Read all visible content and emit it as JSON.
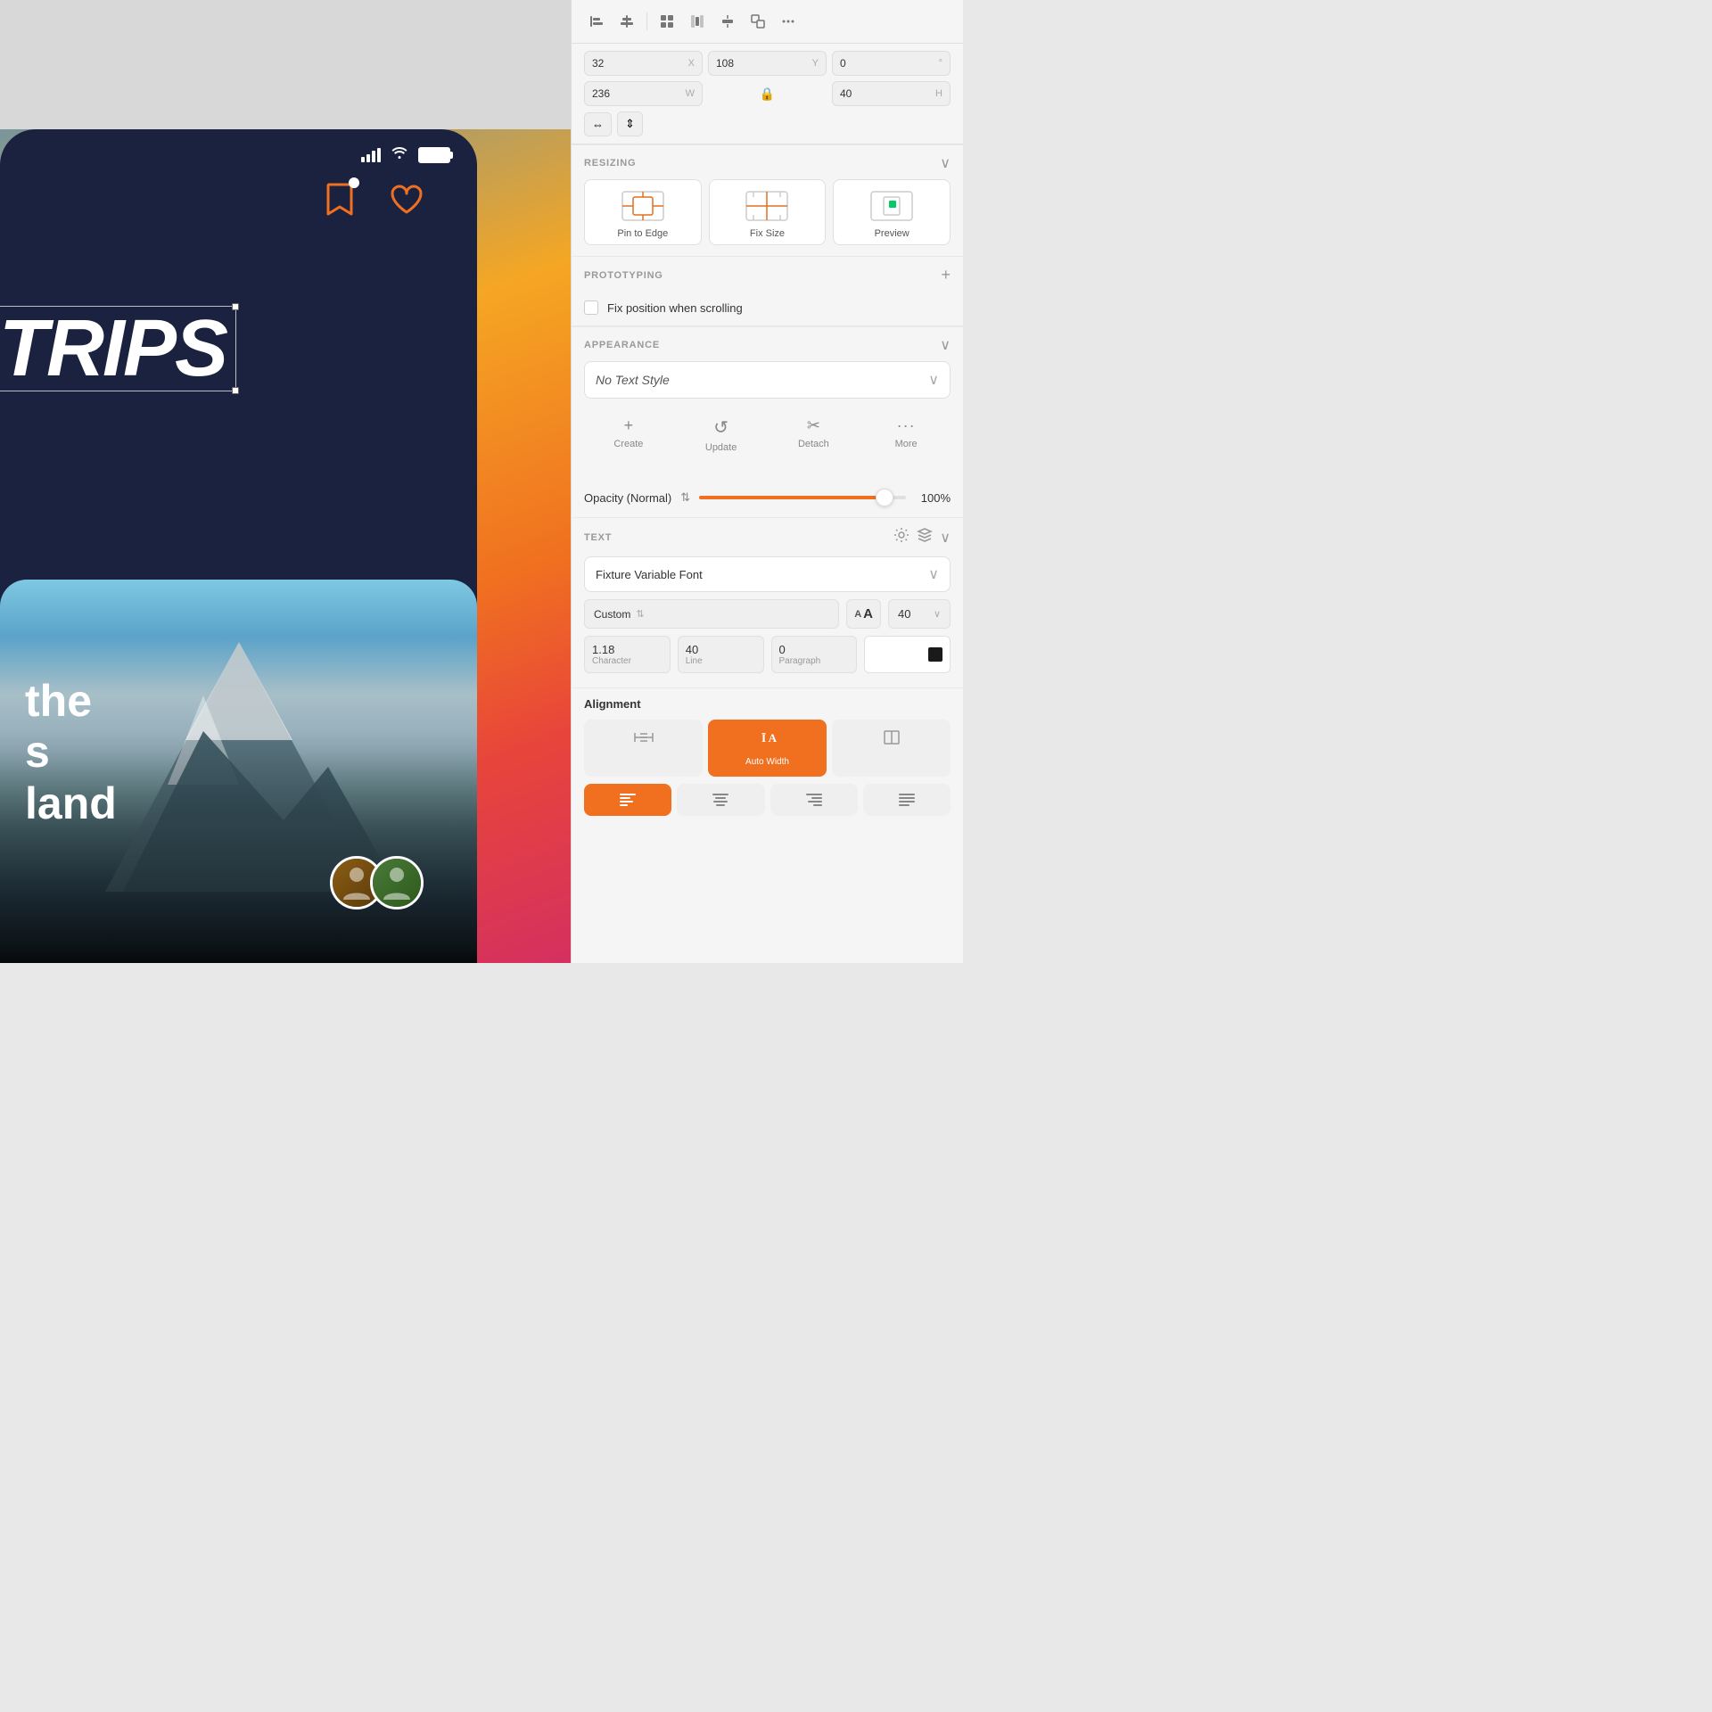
{
  "canvas": {
    "trips_text": "TRIPS",
    "bottom_text_line1": "the",
    "bottom_text_line2": "s",
    "bottom_text_line3": "land"
  },
  "toolbar": {
    "icons": [
      "⊞",
      "⊟",
      "⋮",
      "⊠",
      "⊕",
      "⊡",
      "⊞",
      "⊟"
    ]
  },
  "coords": {
    "x_label": "X",
    "x_value": "32",
    "y_label": "Y",
    "y_value": "108",
    "rotation_value": "0",
    "rotation_symbol": "°",
    "w_label": "W",
    "w_value": "236",
    "h_label": "H",
    "h_value": "40"
  },
  "resizing": {
    "title": "RESIZING",
    "options": [
      {
        "label": "Pin to Edge",
        "id": "pin-to-edge"
      },
      {
        "label": "Fix Size",
        "id": "fix-size"
      },
      {
        "label": "Preview",
        "id": "preview"
      }
    ]
  },
  "prototyping": {
    "title": "PROTOTYPING"
  },
  "fix_position": {
    "label": "Fix position when scrolling"
  },
  "appearance": {
    "title": "APPEARANCE",
    "text_style": "No Text Style",
    "actions": [
      {
        "label": "Create",
        "icon": "+"
      },
      {
        "label": "Update",
        "icon": "↺"
      },
      {
        "label": "Detach",
        "icon": "✂"
      },
      {
        "label": "More",
        "icon": "···"
      }
    ]
  },
  "opacity": {
    "label": "Opacity (Normal)",
    "value": "100%",
    "percent": 100
  },
  "text": {
    "title": "TEXT",
    "font_name": "Fixture Variable Font",
    "weight": "Custom",
    "size": "40",
    "character_spacing": "1.18",
    "character_label": "Character",
    "line_spacing": "40",
    "line_label": "Line",
    "paragraph_spacing": "0",
    "paragraph_label": "Paragraph"
  },
  "alignment": {
    "title": "Alignment",
    "width_options": [
      {
        "label": "Auto Width",
        "active": true
      }
    ],
    "text_align_options": [
      {
        "icon": "align-left",
        "active": true
      },
      {
        "icon": "align-center",
        "active": false
      },
      {
        "icon": "align-right",
        "active": false
      },
      {
        "icon": "align-justify",
        "active": false
      }
    ]
  }
}
